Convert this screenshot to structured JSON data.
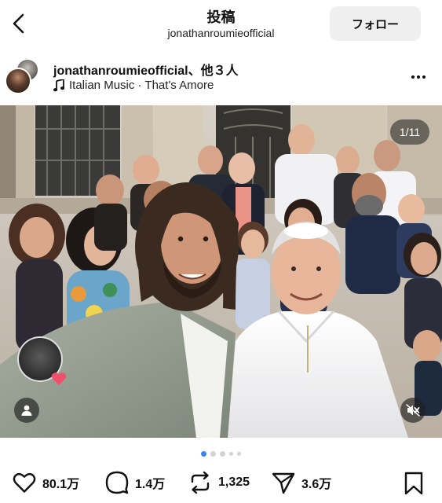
{
  "header": {
    "title": "投稿",
    "subtitle": "jonathanroumieofficial",
    "follow_label": "フォロー"
  },
  "post": {
    "username": "jonathanroumieofficial、他３人",
    "music": "Italian Music · That's Amore",
    "image_counter": "1/11",
    "carousel": {
      "total_dots": 5,
      "active_index": 0
    }
  },
  "actions": {
    "likes": "80.1万",
    "comments": "1.4万",
    "reposts": "1,325",
    "shares": "3.6万"
  },
  "icons": {
    "back": "chevron-left-icon",
    "more": "more-horizontal-icon",
    "music": "music-note-icon",
    "like": "heart-icon",
    "comment": "comment-bubble-icon",
    "repost": "repost-icon",
    "share": "paper-plane-icon",
    "save": "bookmark-icon",
    "tag": "person-icon",
    "mute": "speaker-muted-icon"
  },
  "colors": {
    "active_dot": "#3b82f6",
    "follow_bg": "#efefef",
    "heart_badge": "#f0506e"
  }
}
